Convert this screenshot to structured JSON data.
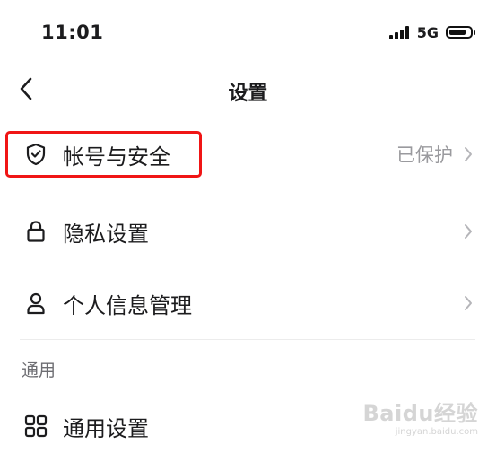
{
  "status_bar": {
    "time": "11:01",
    "network": "5G",
    "signal_bars": 4,
    "battery_level": 0.8
  },
  "nav": {
    "back_icon": "chevron-left-icon",
    "title": "设置"
  },
  "settings": {
    "items": [
      {
        "label": "帐号与安全",
        "value": "已保护",
        "icon": "shield-check-icon",
        "highlighted": true
      },
      {
        "label": "隐私设置",
        "value": "",
        "icon": "lock-icon"
      },
      {
        "label": "个人信息管理",
        "value": "",
        "icon": "person-icon"
      }
    ]
  },
  "general_section": {
    "title": "通用",
    "items": [
      {
        "label": "通用设置",
        "icon": "grid-icon"
      }
    ]
  },
  "watermark": {
    "logo": "Baidu经验",
    "sub": "jingyan.baidu.com"
  },
  "colors": {
    "highlight_border": "#f01515",
    "secondary_text": "#9a9a9e"
  }
}
